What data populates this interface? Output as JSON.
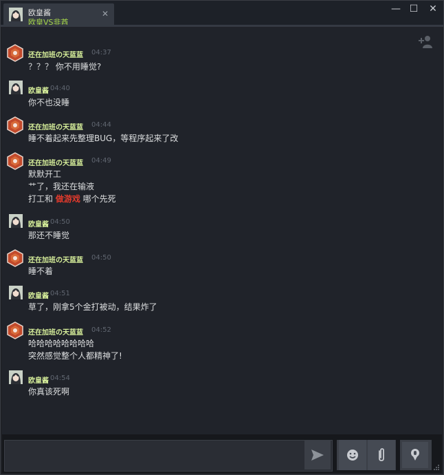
{
  "tab": {
    "name": "欧皇酱",
    "subtitle": "欧皇VS非酋",
    "close_glyph": "✕"
  },
  "window_controls": {
    "minimize": "—",
    "maximize": "☐",
    "close": "✕"
  },
  "colors": {
    "username": "#d6ee9a",
    "subtitle_green": "#a7d84b",
    "highlight_red": "#e23a2c",
    "background": "#20232a"
  },
  "messages": [
    {
      "user": "还在加班の天蓝蓝",
      "avatar": "hexagon-avatar-icon",
      "time": "04:37",
      "lines": [
        "？？？ 你不用睡觉?"
      ]
    },
    {
      "user": "欧皇酱",
      "avatar": "anime-avatar-icon",
      "time": "04:40",
      "lines": [
        "你不也没睡"
      ]
    },
    {
      "user": "还在加班の天蓝蓝",
      "avatar": "hexagon-avatar-icon",
      "time": "04:44",
      "lines": [
        "睡不着起来先整理BUG，等程序起来了改"
      ]
    },
    {
      "user": "还在加班の天蓝蓝",
      "avatar": "hexagon-avatar-icon",
      "time": "04:49",
      "lines": [
        "默默开工",
        "艹了，我还在输液"
      ]
    },
    {
      "user": "欧皇酱",
      "avatar": "anime-avatar-icon",
      "time": "04:50",
      "lines": [
        "那还不睡觉"
      ]
    },
    {
      "user": "还在加班の天蓝蓝",
      "avatar": "hexagon-avatar-icon",
      "time": "04:50",
      "lines": [
        "睡不着"
      ]
    },
    {
      "user": "欧皇酱",
      "avatar": "anime-avatar-icon",
      "time": "04:51",
      "lines": [
        "草了，刚拿5个金打被动，结果炸了"
      ]
    },
    {
      "user": "还在加班の天蓝蓝",
      "avatar": "hexagon-avatar-icon",
      "time": "04:52",
      "lines": [
        "哈哈哈哈哈哈哈哈",
        "突然感觉整个人都精神了!"
      ]
    },
    {
      "user": "欧皇酱",
      "avatar": "anime-avatar-icon",
      "time": "04:54",
      "lines": [
        "你真该死啊"
      ]
    }
  ],
  "rich_line": {
    "before": "打工和 ",
    "highlight": "做游戏",
    "after": " 哪个先死"
  },
  "composer": {
    "input_value": "",
    "icons": [
      "send-icon",
      "emoticon-icon",
      "attachment-icon",
      "voice-icon"
    ]
  }
}
